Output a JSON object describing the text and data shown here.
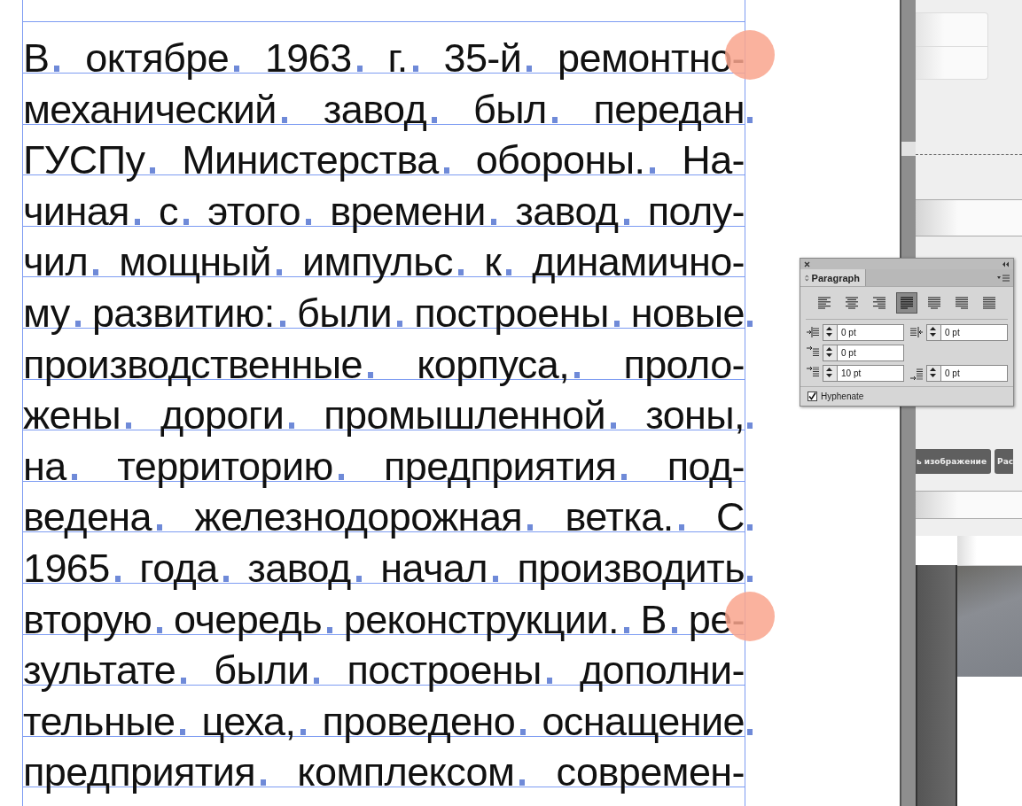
{
  "text_frame": {
    "lines": [
      {
        "text": "В октябре 1963 г. 35-й ремонтно-",
        "end_mark": false,
        "highlighted": true
      },
      {
        "text": "механический завод был передан",
        "end_mark": true,
        "highlighted": false
      },
      {
        "text": "ГУСПу Министерства обороны. На-",
        "end_mark": false,
        "highlighted": false
      },
      {
        "text": "чиная с этого времени завод полу-",
        "end_mark": false,
        "highlighted": false
      },
      {
        "text": "чил мощный импульс к динамично-",
        "end_mark": false,
        "highlighted": false
      },
      {
        "text": "му развитию: были построены новые",
        "end_mark": true,
        "highlighted": false
      },
      {
        "text": "производственные корпуса, проло-",
        "end_mark": false,
        "highlighted": false
      },
      {
        "text": "жены дороги промышленной зоны,",
        "end_mark": true,
        "highlighted": false
      },
      {
        "text": "на территорию предприятия под-",
        "end_mark": false,
        "highlighted": false
      },
      {
        "text": "ведена железнодорожная ветка. С",
        "end_mark": true,
        "highlighted": false
      },
      {
        "text": "1965 года завод начал производить",
        "end_mark": true,
        "highlighted": false
      },
      {
        "text": "вторую очередь реконструкции. В ре-",
        "end_mark": false,
        "highlighted": true
      },
      {
        "text": "зультате были построены дополни-",
        "end_mark": false,
        "highlighted": false
      },
      {
        "text": "тельные цеха, проведено оснащение",
        "end_mark": true,
        "highlighted": false
      },
      {
        "text": "предприятия комплексом современ-",
        "end_mark": false,
        "highlighted": false
      }
    ]
  },
  "background_page": {
    "buttons": [
      "ь изображение",
      "Рас"
    ]
  },
  "paragraph_panel": {
    "title": "Paragraph",
    "alignment": [
      {
        "selected": false
      },
      {
        "selected": false
      },
      {
        "selected": false
      },
      {
        "selected": true
      },
      {
        "selected": false
      },
      {
        "selected": false
      },
      {
        "selected": false
      }
    ],
    "fields": [
      {
        "kind": "left_indent",
        "value": "0 pt"
      },
      {
        "kind": "right_indent",
        "value": "0 pt"
      },
      {
        "kind": "first_line_indent",
        "value": "0 pt"
      },
      {
        "kind": "space_before",
        "value": "10 pt"
      },
      {
        "kind": "space_after",
        "value": "0 pt"
      }
    ],
    "hyphenate": {
      "label": "Hyphenate",
      "checked": true
    }
  }
}
